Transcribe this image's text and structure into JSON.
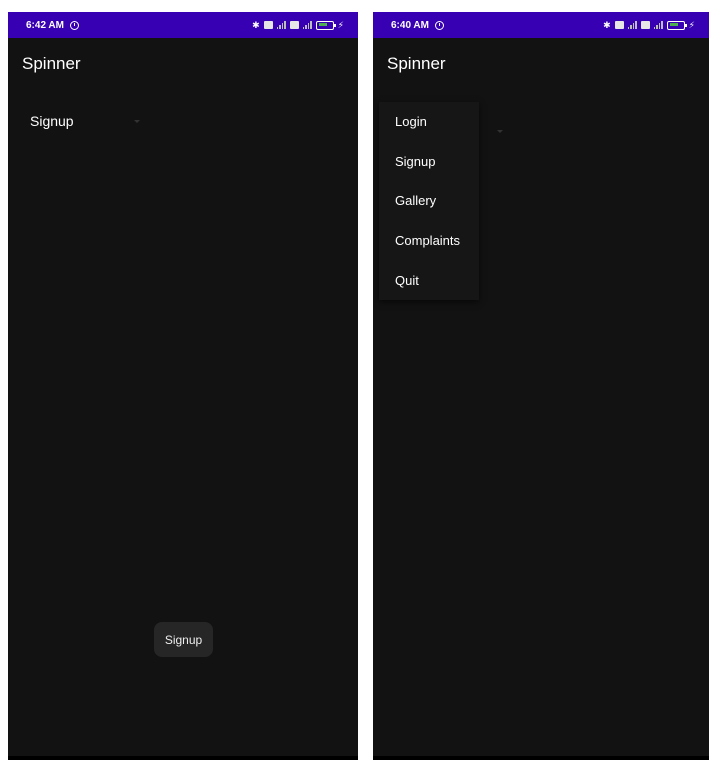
{
  "left": {
    "status": {
      "time": "6:42 AM"
    },
    "app_title": "Spinner",
    "spinner": {
      "selected": "Signup"
    },
    "toast": "Signup"
  },
  "right": {
    "status": {
      "time": "6:40 AM"
    },
    "app_title": "Spinner",
    "dropdown": {
      "items": [
        {
          "label": "Login"
        },
        {
          "label": "Signup"
        },
        {
          "label": "Gallery"
        },
        {
          "label": "Complaints"
        },
        {
          "label": "Quit"
        }
      ]
    }
  },
  "icons": {
    "status_left": [
      "alarm-icon"
    ],
    "status_right": [
      "bluetooth-icon",
      "sim-icon",
      "signal-icon",
      "sim-icon",
      "signal-icon",
      "battery-icon",
      "charging-icon"
    ],
    "dropdown": "dropdown-arrow-icon"
  },
  "colors": {
    "status_bar": "#3700b3",
    "background": "#121212",
    "text": "#ffffff",
    "toast_bg": "#262626"
  }
}
